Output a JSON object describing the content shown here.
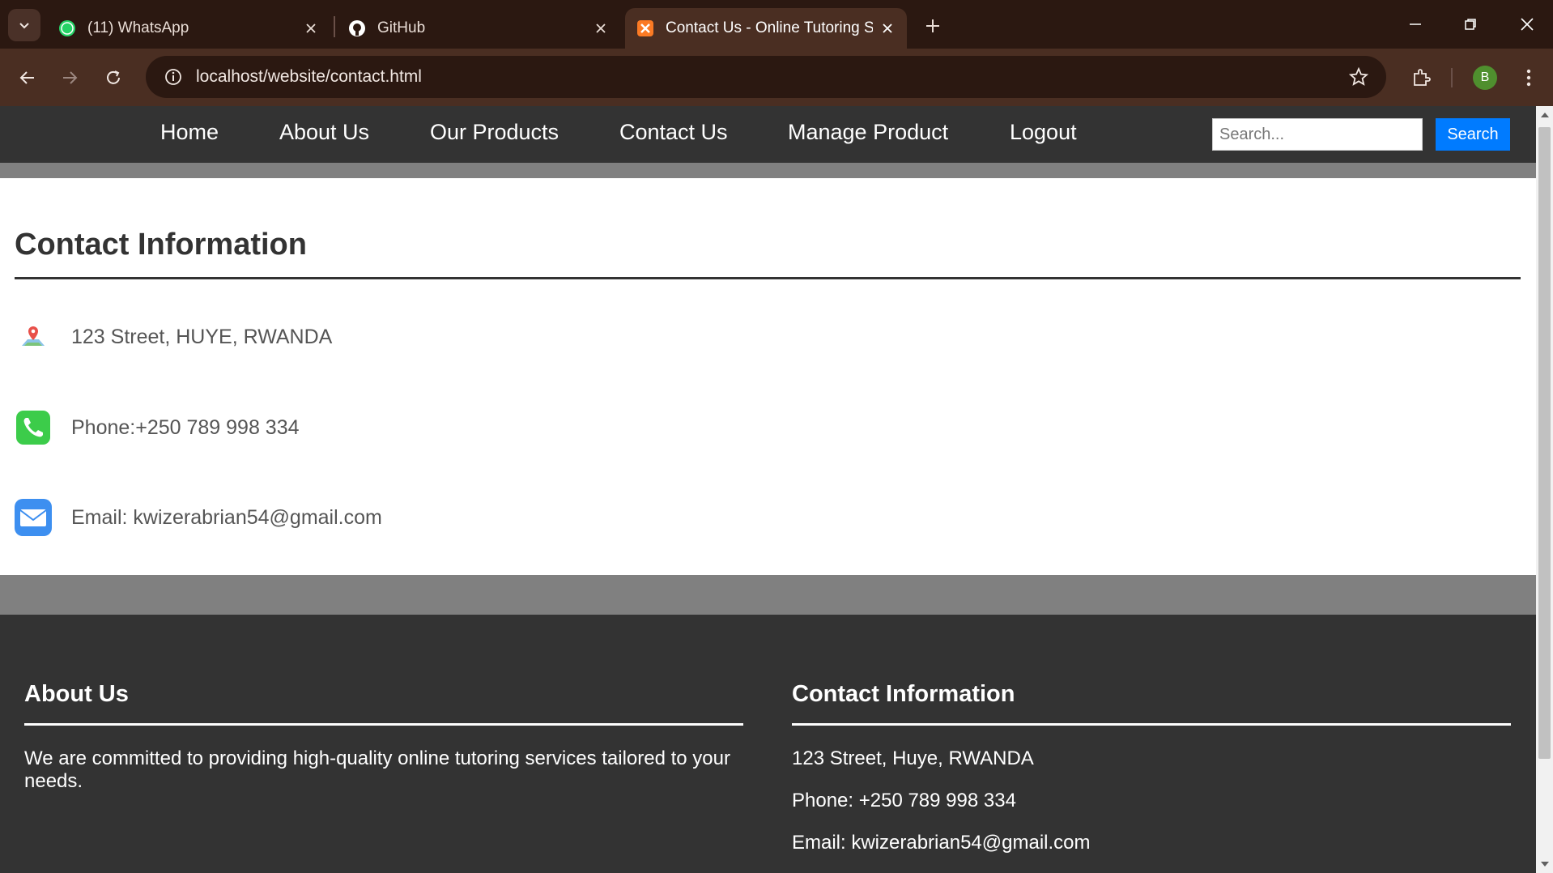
{
  "browser": {
    "tabs": [
      {
        "title": "(11) WhatsApp",
        "badge": "11"
      },
      {
        "title": "GitHub"
      },
      {
        "title": "Contact Us - Online Tutoring Services"
      }
    ],
    "url": "localhost/website/contact.html",
    "profile_initial": "B"
  },
  "nav": {
    "items": [
      "Home",
      "About Us",
      "Our Products",
      "Contact Us",
      "Manage Product",
      "Logout"
    ],
    "search_placeholder": "Search...",
    "search_button": "Search"
  },
  "contact": {
    "title": "Contact Information",
    "address": "123 Street, HUYE, RWANDA",
    "phone": "Phone:+250 789 998 334",
    "email": "Email: kwizerabrian54@gmail.com"
  },
  "footer": {
    "about_title": "About Us",
    "about_text": "We are committed to providing high-quality online tutoring services tailored to your needs.",
    "contact_title": "Contact Information",
    "address": "123 Street, Huye, RWANDA",
    "phone": "Phone: +250 789 998 334",
    "email": "Email: kwizerabrian54@gmail.com"
  },
  "colors": {
    "nav_bg": "#333333",
    "search_button": "#007bff",
    "band_gray": "#808080",
    "browser_frame": "#2b1811"
  }
}
